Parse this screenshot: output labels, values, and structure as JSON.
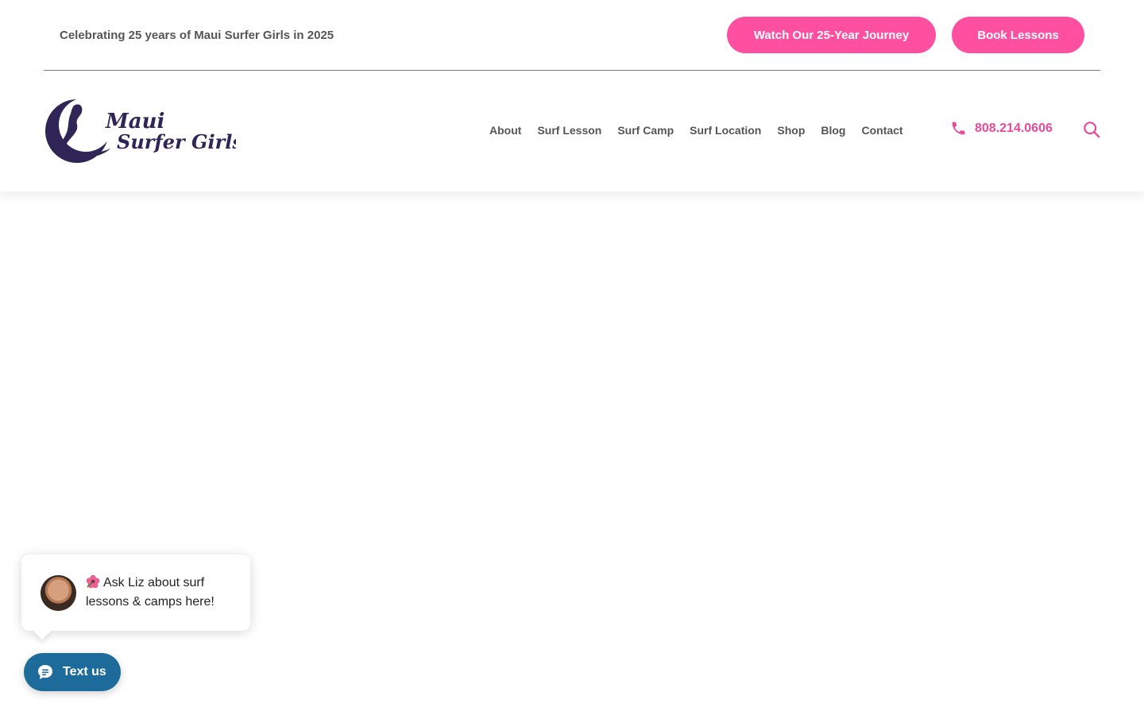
{
  "topbar": {
    "announcement": "Celebrating 25 years of Maui Surfer Girls in 2025",
    "journey_label": "Watch Our 25-Year Journey",
    "book_label": "Book Lessons"
  },
  "brand": {
    "logo_line1": "Maui",
    "logo_line2": "Surfer Girls",
    "primary_color": "#ff4fa0",
    "logo_color": "#2f2557"
  },
  "nav": {
    "items": [
      {
        "label": "About"
      },
      {
        "label": "Surf Lesson"
      },
      {
        "label": "Surf Camp"
      },
      {
        "label": "Surf Location"
      },
      {
        "label": "Shop"
      },
      {
        "label": "Blog"
      },
      {
        "label": "Contact"
      }
    ],
    "phone": "808.214.0606",
    "phone_icon": "phone-icon",
    "search_icon": "search-icon"
  },
  "chat": {
    "message_line1": "Ask Liz about surf",
    "message_line2": "lessons & camps here!",
    "button_label": "Text us",
    "button_color": "#1d6b9a"
  }
}
